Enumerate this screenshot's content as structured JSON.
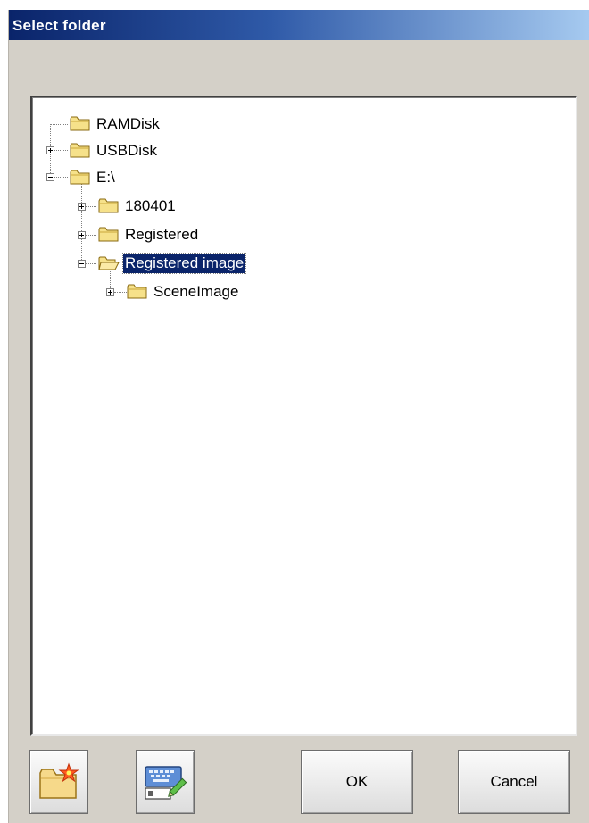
{
  "window": {
    "title": "Select folder"
  },
  "tree": {
    "nodes": [
      {
        "label": "RAMDisk",
        "level": 1,
        "expander": "none"
      },
      {
        "label": "USBDisk",
        "level": 1,
        "expander": "collapsed"
      },
      {
        "label": "E:\\",
        "level": 1,
        "expander": "expanded"
      },
      {
        "label": "180401",
        "level": 2,
        "expander": "collapsed"
      },
      {
        "label": "Registered",
        "level": 2,
        "expander": "collapsed"
      },
      {
        "label": "Registered image",
        "level": 2,
        "expander": "expanded",
        "selected": true
      },
      {
        "label": "SceneImage",
        "level": 3,
        "expander": "collapsed"
      }
    ]
  },
  "toolbar": {
    "new_folder_icon": "new-folder-icon",
    "rename_icon": "keyboard-edit-icon",
    "ok_label": "OK",
    "cancel_label": "Cancel"
  },
  "colors": {
    "title_start": "#0a246a",
    "title_end": "#a6caf0",
    "selection": "#0a246a",
    "folder_fill": "#f6e18a"
  }
}
